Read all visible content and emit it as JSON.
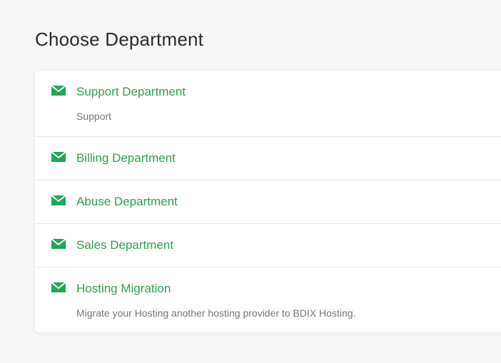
{
  "page": {
    "title": "Choose Department"
  },
  "colors": {
    "accent": "#2e9e52",
    "icon": "#1fa855",
    "title": "#2b2b2b",
    "description": "#777777",
    "background": "#f8f8f8"
  },
  "departments": [
    {
      "name": "Support Department",
      "description": "Support",
      "icon": "envelope-icon"
    },
    {
      "name": "Billing Department",
      "description": "",
      "icon": "envelope-icon"
    },
    {
      "name": "Abuse Department",
      "description": "",
      "icon": "envelope-icon"
    },
    {
      "name": "Sales Department",
      "description": "",
      "icon": "envelope-icon"
    },
    {
      "name": "Hosting Migration",
      "description": "Migrate your Hosting another hosting provider to BDIX Hosting.",
      "icon": "envelope-icon"
    }
  ]
}
